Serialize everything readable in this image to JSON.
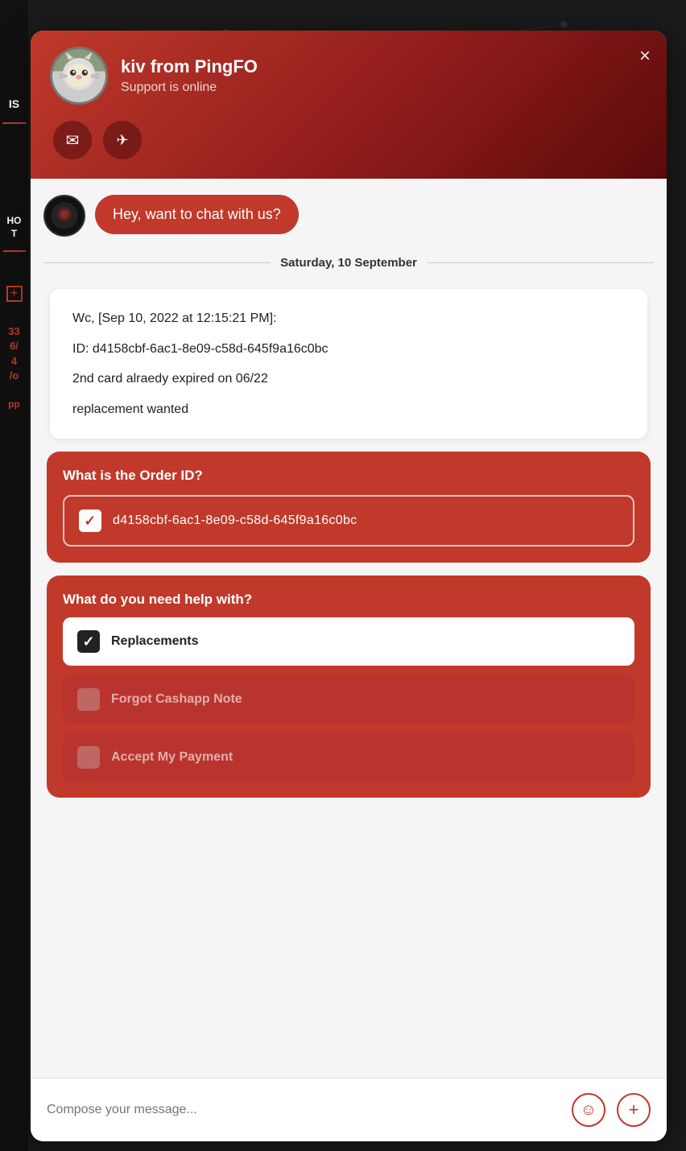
{
  "header": {
    "agent_name": "kiv from PingFO",
    "status": "Support is online",
    "close_label": "×"
  },
  "bot_message": "Hey, want to chat with us?",
  "date_divider": "Saturday, 10 September",
  "message_card": {
    "line1": "Wc, [Sep 10, 2022 at 12:15:21 PM]:",
    "line2": "ID: d4158cbf-6ac1-8e09-c58d-645f9a16c0bc",
    "line3": "2nd card alraedy expired on 06/22",
    "line4": "replacement wanted"
  },
  "order_section": {
    "label": "What is the Order ID?",
    "value": "d4158cbf-6ac1-8e09-c58d-645f9a16c0bc"
  },
  "help_section": {
    "label": "What do you need help with?",
    "options": [
      {
        "label": "Replacements",
        "selected": true
      },
      {
        "label": "Forgot Cashapp Note",
        "selected": false
      },
      {
        "label": "Accept My Payment",
        "selected": false
      }
    ]
  },
  "footer": {
    "placeholder": "Compose your message...",
    "emoji_icon": "emoji-icon",
    "add_icon": "add-icon"
  }
}
